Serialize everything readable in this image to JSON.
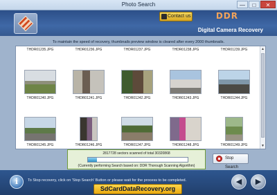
{
  "window": {
    "title": "Photo Search",
    "controls": {
      "minimize": "—",
      "maximize": "□",
      "close": "✕"
    }
  },
  "header": {
    "contact_label": "Contact us",
    "brand": "DDR",
    "subtitle": "Digital Camera Recovery",
    "logo_icon": "recovery-logo-icon"
  },
  "info_text": "To maintain the speed of recovery, thumbnails preview window is cleared after every 2000 thumbnails.",
  "thumbnails": {
    "top_captions": [
      "THDR01235.JPG",
      "THDR01236.JPG",
      "THDR01237.JPG",
      "THDR01238.JPG",
      "THDR01239.JPG"
    ],
    "rows": [
      [
        "THDR01240.JPG",
        "THDR01241.JPG",
        "THDR01242.JPG",
        "THDR01243.JPG",
        "THDR01244.JPG"
      ],
      [
        "THDR01245.JPG",
        "THDR01246.JPG",
        "THDR01247.JPG",
        "THDR01248.JPG",
        "THDR01249.JPG"
      ]
    ]
  },
  "status": {
    "sectors_text": "2817728 sectors scanned of total 30320868",
    "progress_fraction": 0.093,
    "current_search": "(Currently performing Search based on:  DDR Thorough Scanning Algorithm)"
  },
  "stop_button": {
    "label": "Stop Search",
    "icon": "stop-icon"
  },
  "footer": {
    "info_icon_glyph": "i",
    "instruction": "To Stop recovery, click on 'Stop Search' Button or please wait for the process to be completed.",
    "site": "SdCardDataRecovery.org",
    "back_glyph": "◀",
    "next_glyph": "▶"
  },
  "colors": {
    "banner": "#3f68a6",
    "brand": "#f2a35a",
    "progress": "#2f94c9",
    "site_banner": "#ffd54a"
  }
}
